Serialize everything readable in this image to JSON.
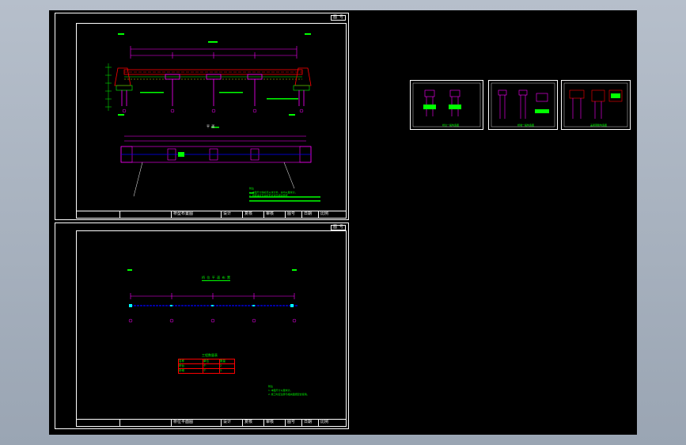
{
  "sheets": {
    "top": {
      "tag": "图 号",
      "main_title": "桥型布置图",
      "plan_title": "平 面",
      "notes_label": "附注",
      "note_lines": [
        "1.本图尺寸除标高以米计外，余均以厘米计。",
        "2.桥面净宽及护栏形式详见相关图纸。"
      ],
      "title_block": [
        "桥型布置图",
        "设计",
        "复核",
        "审核",
        "图号",
        "日期",
        "比例"
      ]
    },
    "bottom": {
      "tag": "图 号",
      "plan_title": "桥 位 平 面 布 置",
      "table_title": "工程数量表",
      "table_rows": [
        [
          "名称",
          "单位",
          "数量"
        ],
        [
          "桥台",
          "个",
          "2"
        ],
        [
          "桥墩",
          "个",
          "3"
        ]
      ],
      "notes_label": "附注",
      "note_lines": [
        "1.本图尺寸以厘米计。",
        "2.施工时应注意与相关图纸配合使用。"
      ],
      "title_block": [
        "桥位平面图",
        "设计",
        "复核",
        "审核",
        "图号",
        "日期",
        "比例"
      ]
    }
  },
  "thumbnails": [
    {
      "label": "桥台一般构造图"
    },
    {
      "label": "桥墩一般构造图"
    },
    {
      "label": "盖梁钢筋构造图"
    }
  ],
  "colors": {
    "background": "#a6b0bd",
    "model_space": "#000000",
    "frame": "#ffffff",
    "magenta": "#ff00ff",
    "red": "#ff0000",
    "green": "#00ff00",
    "blue": "#0000ff",
    "cyan": "#00ffff"
  }
}
